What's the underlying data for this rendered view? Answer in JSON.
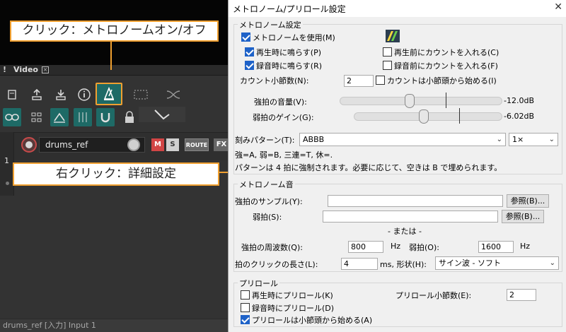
{
  "annotations": {
    "top_callout": "クリック：メトロノームオン/オフ",
    "right_callout": "右クリック：詳細設定"
  },
  "daw": {
    "tab_marker": "!",
    "tab_name": "Video",
    "track": {
      "number": "1",
      "name": "drums_ref",
      "mute_label": "M",
      "solo_label": "S",
      "route_label": "ROUTE",
      "fx_label": "FX"
    },
    "status": "drums_ref [入力] Input 1",
    "icons": [
      "file-icon",
      "upload-icon",
      "download-icon",
      "info-icon",
      "metronome-icon",
      "selection-box-icon",
      "crossfade-icon",
      "link-icon",
      "grid-icon",
      "ripple-icon",
      "snap-grid-icon",
      "magnet-icon",
      "lock-icon",
      "envelope-icon"
    ]
  },
  "dialog": {
    "title": "メトロノーム/プリロール設定",
    "close": "✕",
    "metronome_settings": {
      "legend": "メトロノーム設定",
      "use_metronome": {
        "label": "メトロノームを使用(M)",
        "checked": true
      },
      "play_during_playback": {
        "label": "再生時に鳴らす(P)",
        "checked": true
      },
      "play_during_recording": {
        "label": "録音時に鳴らす(R)",
        "checked": true
      },
      "count_in_playback": {
        "label": "再生前にカウントを入れる(C)",
        "checked": false
      },
      "count_in_recording": {
        "label": "録音前にカウントを入れる(F)",
        "checked": false
      },
      "count_measures_label": "カウント小節数(N):",
      "count_measures_value": "2",
      "count_from_measure_start": {
        "label": "カウントは小節頭から始める(I)",
        "checked": false
      },
      "accent_volume_label": "強拍の音量(V):",
      "accent_volume_value": "-12.0dB",
      "accent_volume_level": 0.43,
      "weak_gain_label": "弱拍のゲイン(G):",
      "weak_gain_value": "-6.02dB",
      "weak_gain_level": 0.47,
      "pattern_label": "刻みパターン(T):",
      "pattern_value": "ABBB",
      "pattern_rate": "1×",
      "legend_text": "強=A, 弱=B, 三連=T, 休=.",
      "pattern_note": "パターンは 4 拍に強制されます。必要に応じて、空きは B で埋められます。"
    },
    "metronome_sound": {
      "legend": "メトロノーム音",
      "accent_sample_label": "強拍のサンプル(Y):",
      "accent_sample_value": "",
      "weak_sample_label": "弱拍(S):",
      "weak_sample_value": "",
      "browse_label": "参照(B)...",
      "or_label": "- または -",
      "accent_freq_label": "強拍の周波数(Q):",
      "accent_freq_value": "800",
      "weak_freq_label": "弱拍(O):",
      "weak_freq_value": "1600",
      "hz": "Hz",
      "click_length_label": "拍のクリックの長さ(L):",
      "click_length_value": "4",
      "ms_shape_label": "ms, 形状(H):",
      "shape_value": "サイン波 - ソフト"
    },
    "preroll": {
      "legend": "プリロール",
      "preroll_playback": {
        "label": "再生時にプリロール(K)",
        "checked": false
      },
      "preroll_recording": {
        "label": "録音時にプリロール(D)",
        "checked": false
      },
      "preroll_from_measure_start": {
        "label": "プリロールは小節頭から始める(A)",
        "checked": true
      },
      "preroll_measures_label": "プリロール小節数(E):",
      "preroll_measures_value": "2"
    }
  }
}
